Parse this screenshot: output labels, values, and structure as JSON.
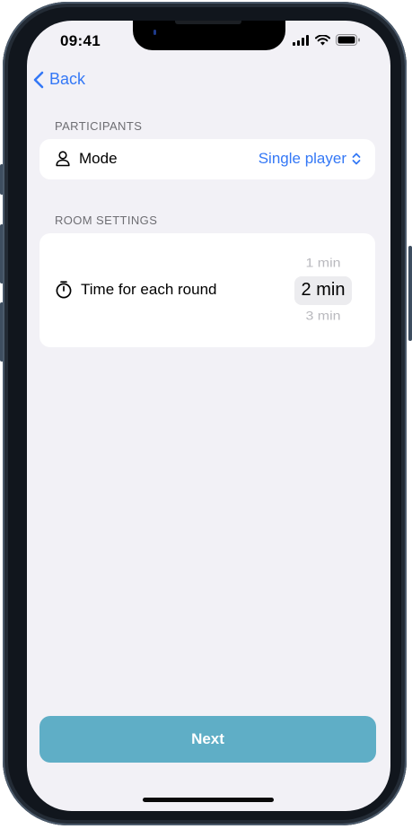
{
  "status_bar": {
    "time": "09:41"
  },
  "nav": {
    "back_label": "Back"
  },
  "participants": {
    "section_title": "PARTICIPANTS",
    "mode_label": "Mode",
    "mode_value": "Single player"
  },
  "room_settings": {
    "section_title": "ROOM SETTINGS",
    "time_label": "Time for each round",
    "picker_options": [
      "1 min",
      "2 min",
      "3 min"
    ],
    "picker_selected": "2 min"
  },
  "footer": {
    "next_label": "Next"
  },
  "colors": {
    "accent": "#3478f6",
    "background": "#f2f1f6",
    "next_button": "#5faec6"
  }
}
